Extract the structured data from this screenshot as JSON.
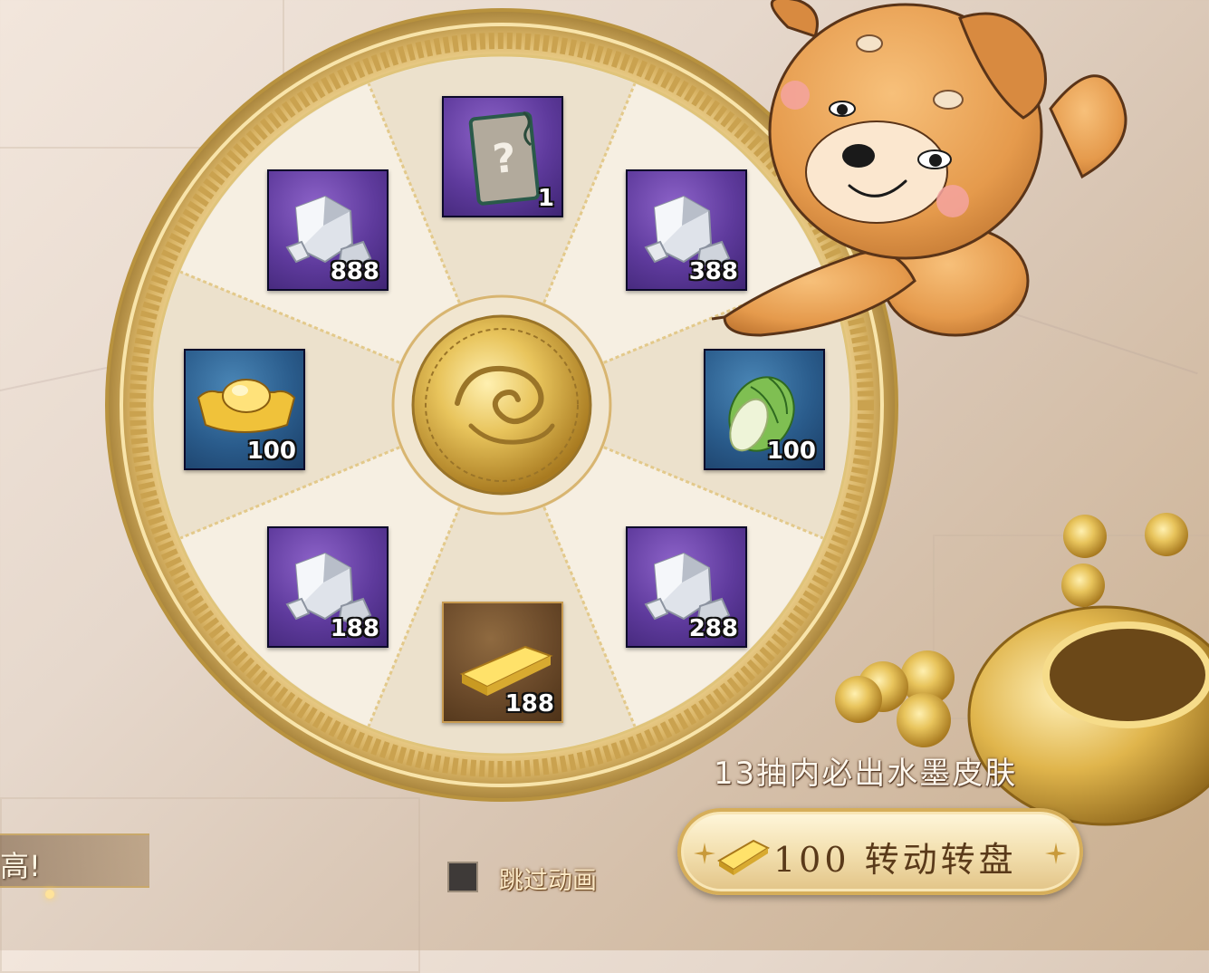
{
  "wheel": {
    "slots": [
      {
        "id": "top",
        "item": "mystery-skin-card",
        "quantity": "1",
        "frame": "purple"
      },
      {
        "id": "upper-right",
        "item": "silver-ore",
        "quantity": "388",
        "frame": "purple"
      },
      {
        "id": "right",
        "item": "cabbage",
        "quantity": "100",
        "frame": "blue"
      },
      {
        "id": "lower-right",
        "item": "silver-ore",
        "quantity": "288",
        "frame": "purple"
      },
      {
        "id": "bottom",
        "item": "gold-bar",
        "quantity": "188",
        "frame": "brown"
      },
      {
        "id": "lower-left",
        "item": "silver-ore",
        "quantity": "188",
        "frame": "purple"
      },
      {
        "id": "left",
        "item": "gold-ingot",
        "quantity": "100",
        "frame": "blue"
      },
      {
        "id": "upper-left",
        "item": "silver-ore",
        "quantity": "888",
        "frame": "purple"
      }
    ],
    "center_icon": "cloud-coin-icon"
  },
  "guarantee_text": "13抽内必出水墨皮肤",
  "spin_button": {
    "cost": "100",
    "label": "转动转盘",
    "currency_icon": "gold-bar-icon"
  },
  "skip_animation": {
    "label": "跳过动画",
    "checked": false
  },
  "tip_banner": {
    "text": "高!"
  },
  "colors": {
    "wheel_gold": "#d9b465",
    "panel_purple": "#5e3a9c",
    "panel_blue": "#2a5c8c",
    "panel_brown": "#6b4a2a",
    "button_text": "#5a3a1a"
  }
}
